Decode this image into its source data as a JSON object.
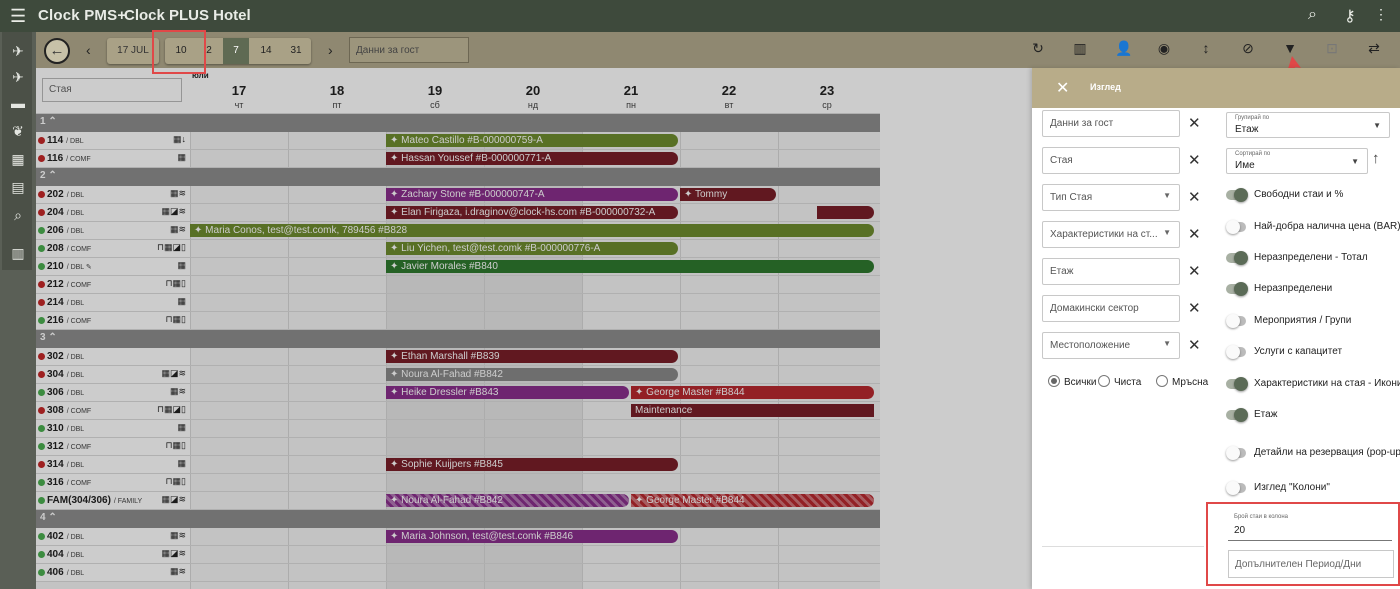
{
  "app": {
    "title": "Clock PMS+",
    "hotel": "Clock PLUS Hotel"
  },
  "topbar_icons": [
    "search-icon",
    "key-icon"
  ],
  "nav_icons": [
    "plane-arrival-icon",
    "plane-departure-icon",
    "bed-icon",
    "leaf-icon",
    "calendar-icon",
    "document-icon",
    "search-icon",
    "book-icon"
  ],
  "toolbar": {
    "date_label": "17 JUL",
    "day_options": [
      "10",
      "2",
      "7",
      "14",
      "31"
    ],
    "guest_placeholder": "Данни за гост",
    "icons": [
      "refresh-icon",
      "columns-icon",
      "add-person-icon",
      "palette-icon",
      "vertical-arrows-icon",
      "clear-filter-icon",
      "filter-icon",
      "focus-icon",
      "swap-icon"
    ]
  },
  "grid": {
    "room_search_placeholder": "Стая",
    "month": "юли",
    "days": [
      {
        "num": "17",
        "wd": "чт"
      },
      {
        "num": "18",
        "wd": "пт"
      },
      {
        "num": "19",
        "wd": "сб"
      },
      {
        "num": "20",
        "wd": "нд"
      },
      {
        "num": "21",
        "wd": "пн"
      },
      {
        "num": "22",
        "wd": "вт"
      },
      {
        "num": "23",
        "wd": "ср"
      }
    ],
    "floors": [
      {
        "name": "1",
        "rooms": [
          {
            "name": "114",
            "type": "/ DBL",
            "status": "red",
            "icons": "▦↓"
          },
          {
            "name": "116",
            "type": "/ COMF",
            "status": "red",
            "icons": "▦"
          }
        ]
      },
      {
        "name": "2",
        "rooms": [
          {
            "name": "202",
            "type": "/ DBL",
            "status": "red",
            "icons": "▦≋"
          },
          {
            "name": "204",
            "type": "/ DBL",
            "status": "red",
            "icons": "▦◪≋"
          },
          {
            "name": "206",
            "type": "/ DBL",
            "status": "green",
            "icons": "▦≋"
          },
          {
            "name": "208",
            "type": "/ COMF",
            "status": "green",
            "icons": "⊓▦◪▯"
          },
          {
            "name": "210",
            "type": "/ DBL ✎",
            "status": "green",
            "icons": "▦"
          },
          {
            "name": "212",
            "type": "/ COMF",
            "status": "red",
            "icons": "⊓▦▯"
          },
          {
            "name": "214",
            "type": "/ DBL",
            "status": "red",
            "icons": "▦"
          },
          {
            "name": "216",
            "type": "/ COMF",
            "status": "green",
            "icons": "⊓▦▯"
          }
        ]
      },
      {
        "name": "3",
        "rooms": [
          {
            "name": "302",
            "type": "/ DBL",
            "status": "red",
            "icons": ""
          },
          {
            "name": "304",
            "type": "/ DBL",
            "status": "red",
            "icons": "▦◪≋"
          },
          {
            "name": "306",
            "type": "/ DBL",
            "status": "green",
            "icons": "▦≋"
          },
          {
            "name": "308",
            "type": "/ COMF",
            "status": "red",
            "icons": "⊓▦◪▯"
          },
          {
            "name": "310",
            "type": "/ DBL",
            "status": "green",
            "icons": "▦"
          },
          {
            "name": "312",
            "type": "/ COMF",
            "status": "green",
            "icons": "⊓▦▯"
          },
          {
            "name": "314",
            "type": "/ DBL",
            "status": "red",
            "icons": "▦"
          },
          {
            "name": "316",
            "type": "/ COMF",
            "status": "green",
            "icons": "⊓▦▯"
          },
          {
            "name": "FAM(304/306)",
            "type": "/ FAMILY",
            "status": "green",
            "icons": "▦◪≋"
          }
        ]
      },
      {
        "name": "4",
        "rooms": [
          {
            "name": "402",
            "type": "/ DBL",
            "status": "green",
            "icons": "▦≋"
          },
          {
            "name": "404",
            "type": "/ DBL",
            "status": "green",
            "icons": "▦◪≋"
          },
          {
            "name": "406",
            "type": "/ DBL",
            "status": "green",
            "icons": "▦≋"
          }
        ]
      }
    ],
    "bookings": [
      {
        "room": "114",
        "label": "Mateo Castillo #B-000000759-A",
        "start": 2,
        "len": 3,
        "color": "#6f8c2f"
      },
      {
        "room": "116",
        "label": "Hassan Youssef #B-000000771-A",
        "start": 2,
        "len": 3,
        "color": "#7a1f28"
      },
      {
        "room": "202",
        "label": "Zachary Stone #B-000000747-A",
        "start": 2,
        "len": 3,
        "color": "#8a2f8c"
      },
      {
        "room": "202",
        "label": "Tommy",
        "start": 5,
        "len": 1,
        "color": "#7a1f28"
      },
      {
        "room": "204",
        "label": "Elan Firigaza, i.draginov@clock-hs.com #B-000000732-A",
        "start": 2,
        "len": 3,
        "color": "#7a1f28"
      },
      {
        "room": "204",
        "label": "",
        "start": 6.4,
        "len": 0.6,
        "color": "#7a1f28"
      },
      {
        "room": "206",
        "label": "Maria Conos, test@test.comk, 789456 #B828",
        "start": 0,
        "len": 7,
        "color": "#6f8c2f"
      },
      {
        "room": "208",
        "label": "Liu Yichen, test@test.comk #B-000000776-A",
        "start": 2,
        "len": 3,
        "color": "#6f8c2f"
      },
      {
        "room": "210",
        "label": "Javier Morales #B840",
        "start": 2,
        "len": 5,
        "color": "#2f7a2f"
      },
      {
        "room": "302",
        "label": "Ethan Marshall #B839",
        "start": 2,
        "len": 3,
        "color": "#7a1f28"
      },
      {
        "room": "304",
        "label": "Noura Al-Fahad #B842",
        "start": 2,
        "len": 3,
        "color": "#8a8a8a"
      },
      {
        "room": "306",
        "label": "Heike Dressler #B843",
        "start": 2,
        "len": 2.5,
        "color": "#8a2f8c"
      },
      {
        "room": "306",
        "label": "George Master #B844",
        "start": 4.5,
        "len": 2.5,
        "color": "#b8292f"
      },
      {
        "room": "308",
        "label": "Maintenance",
        "start": 4.5,
        "len": 2.5,
        "color": "#7a1f28"
      },
      {
        "room": "314",
        "label": "Sophie Kuijpers #B845",
        "start": 2,
        "len": 3,
        "color": "#7a1f28"
      },
      {
        "room": "FAM(304/306)",
        "label": "Noura Al-Fahad #B842",
        "start": 2,
        "len": 2.5,
        "color": "#8a2f8c"
      },
      {
        "room": "FAM(304/306)",
        "label": "George Master #B844",
        "start": 4.5,
        "len": 2.5,
        "color": "#b8292f"
      },
      {
        "room": "402",
        "label": "Maria Johnson, test@test.comk #B846",
        "start": 2,
        "len": 3,
        "color": "#8a2f8c"
      }
    ]
  },
  "panel": {
    "title": "Изглед",
    "filters": [
      {
        "label": "Данни за гост",
        "dropdown": false
      },
      {
        "label": "Стая",
        "dropdown": false
      },
      {
        "label": "Тип Стая",
        "dropdown": true
      },
      {
        "label": "Характеристики на ст...",
        "dropdown": true
      },
      {
        "label": "Етаж",
        "dropdown": false
      },
      {
        "label": "Домакински сектор",
        "dropdown": false
      },
      {
        "label": "Местоположение",
        "dropdown": true
      }
    ],
    "radios": [
      {
        "label": "Всички",
        "on": true
      },
      {
        "label": "Чиста",
        "on": false
      },
      {
        "label": "Мръсна",
        "on": false
      }
    ],
    "group_by": {
      "label": "Групирай по",
      "value": "Етаж"
    },
    "sort_by": {
      "label": "Сортирай по",
      "value": "Име"
    },
    "toggles": [
      {
        "label": "Свободни стаи и %",
        "on": true
      },
      {
        "label": "Най-добра налична цена (BAR)",
        "on": false
      },
      {
        "label": "Неразпределени - Тотал",
        "on": true
      },
      {
        "label": "Неразпределени",
        "on": true
      },
      {
        "label": "Мероприятия / Групи",
        "on": false
      },
      {
        "label": "Услуги с капацитет",
        "on": false
      },
      {
        "label": "Характеристики на стая - Икони",
        "on": true
      },
      {
        "label": "Етаж",
        "on": true
      },
      {
        "label": "Детайли на резервация (pop-up)",
        "on": false
      },
      {
        "label": "Изглед \"Колони\"",
        "on": false
      }
    ],
    "rooms_per_column": {
      "label": "Брой стаи в колона",
      "value": "20"
    },
    "extra_period_placeholder": "Допълнителен Период/Дни"
  }
}
